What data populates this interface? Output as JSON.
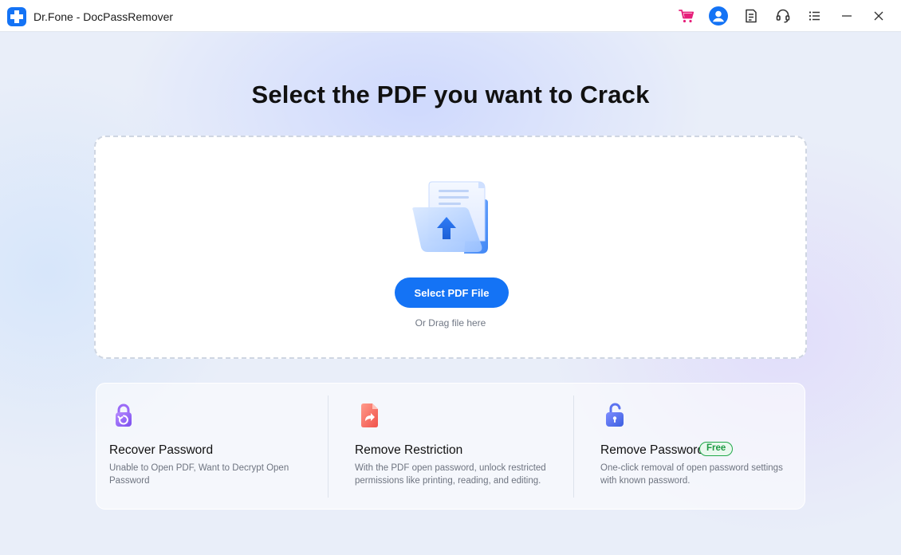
{
  "window": {
    "title": "Dr.Fone - DocPassRemover",
    "icons": [
      "cart-icon",
      "account-icon",
      "notes-icon",
      "support-icon",
      "menu-icon",
      "minimize-icon",
      "close-icon"
    ]
  },
  "main": {
    "title": "Select the PDF you want to Crack",
    "select_button": "Select PDF File",
    "drag_hint": "Or Drag file here"
  },
  "features": [
    {
      "title": "Recover Password",
      "description": "Unable to Open PDF, Want to Decrypt Open Password",
      "icon": "lock-recover-icon"
    },
    {
      "title": "Remove Restriction",
      "description": "With the PDF open password, unlock restricted permissions like printing, reading, and editing.",
      "icon": "file-share-icon"
    },
    {
      "title": "Remove Password",
      "badge": "Free",
      "description": "One-click removal of open password settings with known password.",
      "icon": "unlock-icon"
    }
  ],
  "colors": {
    "accent": "#1473f5",
    "cart": "#e6207a",
    "free_badge": "#22a94a"
  }
}
